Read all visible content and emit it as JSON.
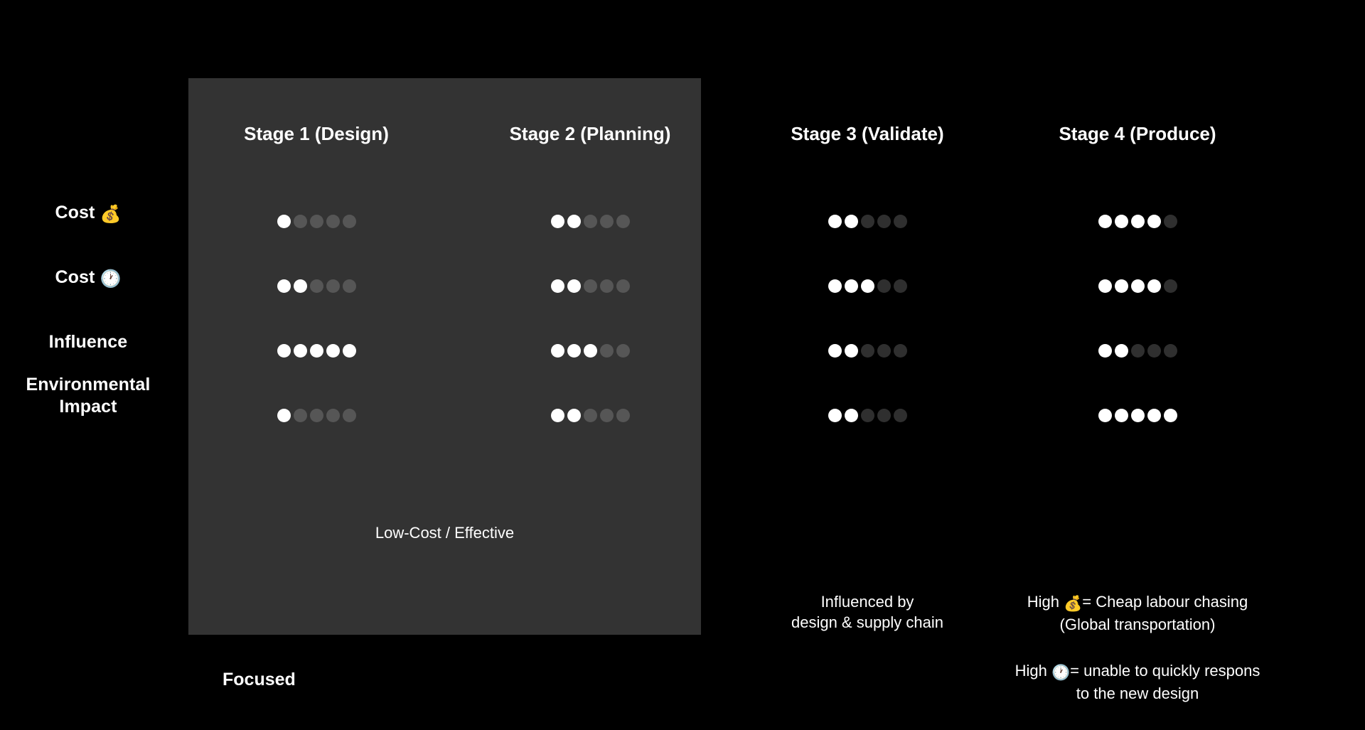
{
  "theme": {
    "background": "#000000",
    "panel_background": "#333333",
    "dot_filled": "#ffffff",
    "dot_empty_on_panel": "#565656",
    "dot_empty_on_black": "#2f2f2f",
    "text": "#ffffff"
  },
  "chart_data": {
    "type": "table",
    "title": "",
    "rating_scale_max": 5,
    "categories": [
      "Cost 💰",
      "Cost 🕐",
      "Influence",
      "Environmental Impact"
    ],
    "columns": [
      "Stage 1 (Design)",
      "Stage 2 (Planning)",
      "Stage 3 (Validate)",
      "Stage 4 (Produce)"
    ],
    "series": [
      {
        "name": "Stage 1 (Design)",
        "values": [
          1,
          2,
          5,
          1
        ]
      },
      {
        "name": "Stage 2 (Planning)",
        "values": [
          2,
          2,
          3,
          2
        ]
      },
      {
        "name": "Stage 3 (Validate)",
        "values": [
          2,
          3,
          2,
          2
        ]
      },
      {
        "name": "Stage 4 (Produce)",
        "values": [
          4,
          4,
          2,
          5
        ]
      }
    ],
    "annotations": [
      "Low-Cost / Effective",
      "Focused",
      "Influenced by design & supply chain",
      "High 💰= Cheap labour chasing (Global transportation)",
      "High 🕐= unable to quickly respons to the new design"
    ]
  },
  "rows": [
    {
      "label_text": "Cost",
      "emoji": "💰",
      "name": "cost-money"
    },
    {
      "label_text": "Cost",
      "emoji": "🕐",
      "name": "cost-time"
    },
    {
      "label_text": "Influence",
      "emoji": "",
      "name": "influence"
    },
    {
      "label_text": "Environmental Impact",
      "emoji": "",
      "name": "environmental-impact"
    }
  ],
  "row_labels": {
    "cost_money": "Cost",
    "cost_money_emoji": "💰",
    "cost_time": "Cost",
    "cost_time_emoji": "🕐",
    "influence": "Influence",
    "environmental_line1": "Environmental",
    "environmental_line2": "Impact"
  },
  "stages": [
    {
      "title": "Stage 1 (Design)",
      "ratings": [
        1,
        2,
        5,
        1
      ],
      "highlighted": true
    },
    {
      "title": "Stage 2 (Planning)",
      "ratings": [
        2,
        2,
        3,
        2
      ],
      "highlighted": true
    },
    {
      "title": "Stage 3 (Validate)",
      "ratings": [
        2,
        3,
        2,
        2
      ],
      "highlighted": false
    },
    {
      "title": "Stage 4 (Produce)",
      "ratings": [
        4,
        4,
        2,
        5
      ],
      "highlighted": false
    }
  ],
  "notes": {
    "low_cost_effective": "Low-Cost / Effective",
    "focused": "Focused",
    "stage3_line1": "Influenced by",
    "stage3_line2": "design & supply chain",
    "stage4_money_prefix": "High",
    "stage4_money_emoji": "💰",
    "stage4_money_line1_rest": "= Cheap labour chasing",
    "stage4_money_line2": "(Global transportation)",
    "stage4_time_prefix": "High",
    "stage4_time_emoji": "🕐",
    "stage4_time_line1_rest": "= unable to quickly respons",
    "stage4_time_line2": "to the new design"
  }
}
